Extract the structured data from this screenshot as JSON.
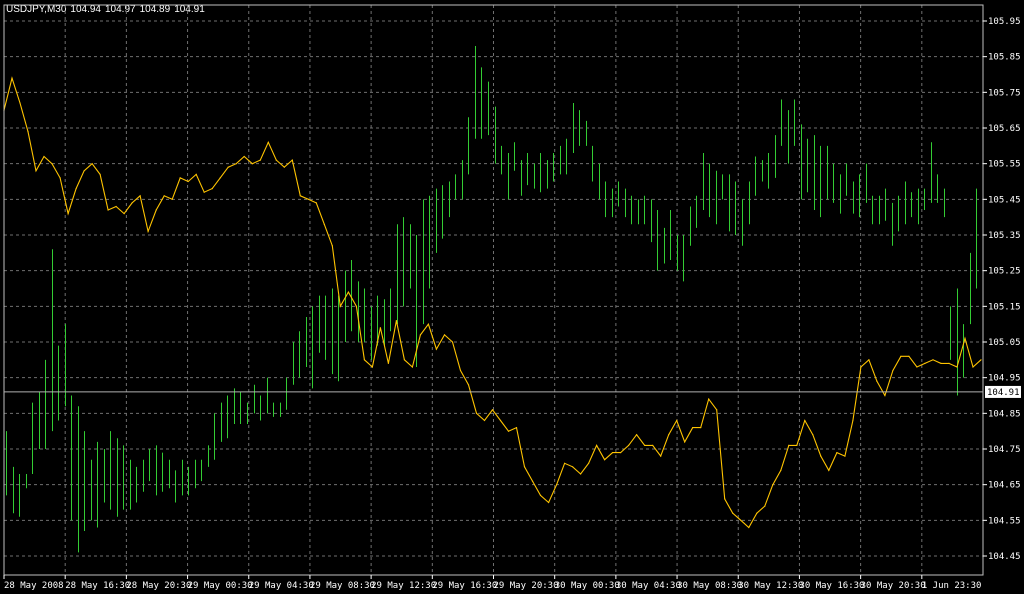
{
  "header": {
    "symbol": "USDJPY,M30",
    "open": "104.94",
    "high": "104.97",
    "low": "104.89",
    "close": "104.91"
  },
  "colors": {
    "background": "#000000",
    "grid": "#707070",
    "axis_text": "#ffffff",
    "bars": "#33cc33",
    "line": "#ffc400",
    "price_line": "#b0b0b0"
  },
  "current_price_label": "104.91",
  "chart_data": {
    "type": "line",
    "title": "USDJPY,M30",
    "grid": true,
    "ylim": [
      104.4,
      106.0
    ],
    "y_ticks": [
      "105.95",
      "105.85",
      "105.75",
      "105.65",
      "105.55",
      "105.45",
      "105.35",
      "105.25",
      "105.15",
      "105.05",
      "104.95",
      "104.85",
      "104.75",
      "104.65",
      "104.55",
      "104.45"
    ],
    "x_tick_labels": [
      "28 May 2008",
      "28 May 16:30",
      "28 May 20:30",
      "29 May 00:30",
      "29 May 04:30",
      "29 May 08:30",
      "29 May 12:30",
      "29 May 16:30",
      "29 May 20:30",
      "30 May 00:30",
      "30 May 04:30",
      "30 May 08:30",
      "30 May 12:30",
      "30 May 16:30",
      "30 May 20:30",
      "1 Jun 23:30"
    ],
    "x_tick_count": 16,
    "series": [
      {
        "type": "bar",
        "values": [
          [
            104.8,
            104.62
          ],
          [
            104.7,
            104.57
          ],
          [
            104.68,
            104.56
          ],
          [
            104.68,
            104.64
          ],
          [
            104.88,
            104.68
          ],
          [
            104.91,
            104.75
          ],
          [
            105.0,
            104.75
          ],
          [
            105.31,
            104.8
          ],
          [
            105.04,
            104.83
          ],
          [
            105.1,
            104.87
          ],
          [
            104.9,
            104.55
          ],
          [
            104.87,
            104.46
          ],
          [
            104.8,
            104.52
          ],
          [
            104.72,
            104.55
          ],
          [
            104.77,
            104.53
          ],
          [
            104.75,
            104.6
          ],
          [
            104.8,
            104.58
          ],
          [
            104.78,
            104.56
          ],
          [
            104.76,
            104.58
          ],
          [
            104.72,
            104.58
          ],
          [
            104.7,
            104.6
          ],
          [
            104.72,
            104.63
          ],
          [
            104.75,
            104.66
          ],
          [
            104.76,
            104.62
          ],
          [
            104.74,
            104.63
          ],
          [
            104.72,
            104.64
          ],
          [
            104.69,
            104.6
          ],
          [
            104.72,
            104.62
          ],
          [
            104.7,
            104.62
          ],
          [
            104.72,
            104.64
          ],
          [
            104.72,
            104.66
          ],
          [
            104.76,
            104.7
          ],
          [
            104.85,
            104.72
          ],
          [
            104.88,
            104.77
          ],
          [
            104.9,
            104.78
          ],
          [
            104.92,
            104.82
          ],
          [
            104.91,
            104.82
          ],
          [
            104.88,
            104.82
          ],
          [
            104.93,
            104.85
          ],
          [
            104.9,
            104.83
          ],
          [
            104.95,
            104.85
          ],
          [
            104.88,
            104.84
          ],
          [
            104.88,
            104.84
          ],
          [
            104.95,
            104.86
          ],
          [
            105.05,
            104.93
          ],
          [
            105.08,
            104.95
          ],
          [
            105.12,
            104.98
          ],
          [
            105.15,
            104.92
          ],
          [
            105.18,
            105.02
          ],
          [
            105.18,
            105.0
          ],
          [
            105.2,
            104.96
          ],
          [
            105.18,
            104.94
          ],
          [
            105.25,
            105.05
          ],
          [
            105.28,
            105.08
          ],
          [
            105.22,
            105.05
          ],
          [
            105.2,
            105.05
          ],
          [
            105.15,
            105.0
          ],
          [
            105.18,
            105.04
          ],
          [
            105.17,
            105.04
          ],
          [
            105.2,
            105.08
          ],
          [
            105.38,
            105.1
          ],
          [
            105.4,
            105.15
          ],
          [
            105.38,
            105.2
          ],
          [
            105.35,
            104.98
          ],
          [
            105.45,
            105.1
          ],
          [
            105.46,
            105.2
          ],
          [
            105.48,
            105.3
          ],
          [
            105.49,
            105.34
          ],
          [
            105.5,
            105.4
          ],
          [
            105.52,
            105.45
          ],
          [
            105.56,
            105.45
          ],
          [
            105.68,
            105.52
          ],
          [
            105.88,
            105.62
          ],
          [
            105.82,
            105.62
          ],
          [
            105.78,
            105.63
          ],
          [
            105.71,
            105.55
          ],
          [
            105.6,
            105.52
          ],
          [
            105.58,
            105.45
          ],
          [
            105.61,
            105.53
          ],
          [
            105.56,
            105.46
          ],
          [
            105.58,
            105.49
          ],
          [
            105.55,
            105.48
          ],
          [
            105.58,
            105.47
          ],
          [
            105.56,
            105.48
          ],
          [
            105.58,
            105.5
          ],
          [
            105.6,
            105.52
          ],
          [
            105.62,
            105.52
          ],
          [
            105.72,
            105.58
          ],
          [
            105.7,
            105.6
          ],
          [
            105.67,
            105.6
          ],
          [
            105.6,
            105.5
          ],
          [
            105.55,
            105.45
          ],
          [
            105.5,
            105.4
          ],
          [
            105.48,
            105.4
          ],
          [
            105.5,
            105.43
          ],
          [
            105.48,
            105.4
          ],
          [
            105.46,
            105.38
          ],
          [
            105.45,
            105.38
          ],
          [
            105.46,
            105.38
          ],
          [
            105.45,
            105.33
          ],
          [
            105.42,
            105.25
          ],
          [
            105.37,
            105.27
          ],
          [
            105.42,
            105.28
          ],
          [
            105.35,
            105.25
          ],
          [
            105.35,
            105.22
          ],
          [
            105.43,
            105.32
          ],
          [
            105.46,
            105.37
          ],
          [
            105.58,
            105.42
          ],
          [
            105.55,
            105.4
          ],
          [
            105.53,
            105.38
          ],
          [
            105.52,
            105.45
          ],
          [
            105.52,
            105.36
          ],
          [
            105.5,
            105.35
          ],
          [
            105.45,
            105.32
          ],
          [
            105.5,
            105.38
          ],
          [
            105.57,
            105.46
          ],
          [
            105.56,
            105.5
          ],
          [
            105.58,
            105.48
          ],
          [
            105.63,
            105.51
          ],
          [
            105.73,
            105.6
          ],
          [
            105.7,
            105.55
          ],
          [
            105.73,
            105.6
          ],
          [
            105.66,
            105.45
          ],
          [
            105.62,
            105.47
          ],
          [
            105.63,
            105.42
          ],
          [
            105.6,
            105.4
          ],
          [
            105.6,
            105.45
          ],
          [
            105.55,
            105.44
          ],
          [
            105.52,
            105.41
          ],
          [
            105.55,
            105.46
          ],
          [
            105.5,
            105.41
          ],
          [
            105.52,
            105.4
          ],
          [
            105.55,
            105.44
          ],
          [
            105.46,
            105.38
          ],
          [
            105.46,
            105.38
          ],
          [
            105.48,
            105.39
          ],
          [
            105.44,
            105.32
          ],
          [
            105.46,
            105.36
          ],
          [
            105.5,
            105.38
          ],
          [
            105.47,
            105.4
          ],
          [
            105.48,
            105.38
          ],
          [
            105.48,
            105.42
          ],
          [
            105.61,
            105.44
          ],
          [
            105.52,
            105.44
          ],
          [
            105.48,
            105.4
          ],
          [
            105.15,
            105.0
          ],
          [
            105.2,
            104.9
          ],
          [
            105.1,
            104.95
          ],
          [
            105.3,
            105.1
          ],
          [
            105.48,
            105.2
          ]
        ]
      },
      {
        "type": "line",
        "values": [
          105.7,
          105.79,
          105.72,
          105.64,
          105.53,
          105.57,
          105.55,
          105.51,
          105.41,
          105.48,
          105.53,
          105.55,
          105.52,
          105.42,
          105.43,
          105.41,
          105.44,
          105.46,
          105.36,
          105.42,
          105.46,
          105.45,
          105.51,
          105.5,
          105.52,
          105.47,
          105.48,
          105.51,
          105.54,
          105.55,
          105.57,
          105.55,
          105.56,
          105.61,
          105.56,
          105.54,
          105.56,
          105.46,
          105.45,
          105.44,
          105.38,
          105.32,
          105.15,
          105.19,
          105.15,
          105.0,
          104.98,
          105.09,
          104.99,
          105.11,
          105.0,
          104.98,
          105.07,
          105.1,
          105.03,
          105.07,
          105.05,
          104.97,
          104.93,
          104.85,
          104.83,
          104.86,
          104.83,
          104.8,
          104.81,
          104.7,
          104.66,
          104.62,
          104.6,
          104.65,
          104.71,
          104.7,
          104.68,
          104.71,
          104.76,
          104.72,
          104.74,
          104.74,
          104.76,
          104.79,
          104.76,
          104.76,
          104.73,
          104.79,
          104.83,
          104.77,
          104.81,
          104.81,
          104.89,
          104.86,
          104.61,
          104.57,
          104.55,
          104.53,
          104.57,
          104.59,
          104.65,
          104.69,
          104.76,
          104.76,
          104.83,
          104.79,
          104.73,
          104.69,
          104.74,
          104.73,
          104.83,
          104.98,
          105.0,
          104.94,
          104.9,
          104.97,
          105.01,
          105.01,
          104.98,
          104.99,
          105.0,
          104.99,
          104.99,
          104.98,
          105.06,
          104.98,
          105.0
        ]
      }
    ]
  }
}
